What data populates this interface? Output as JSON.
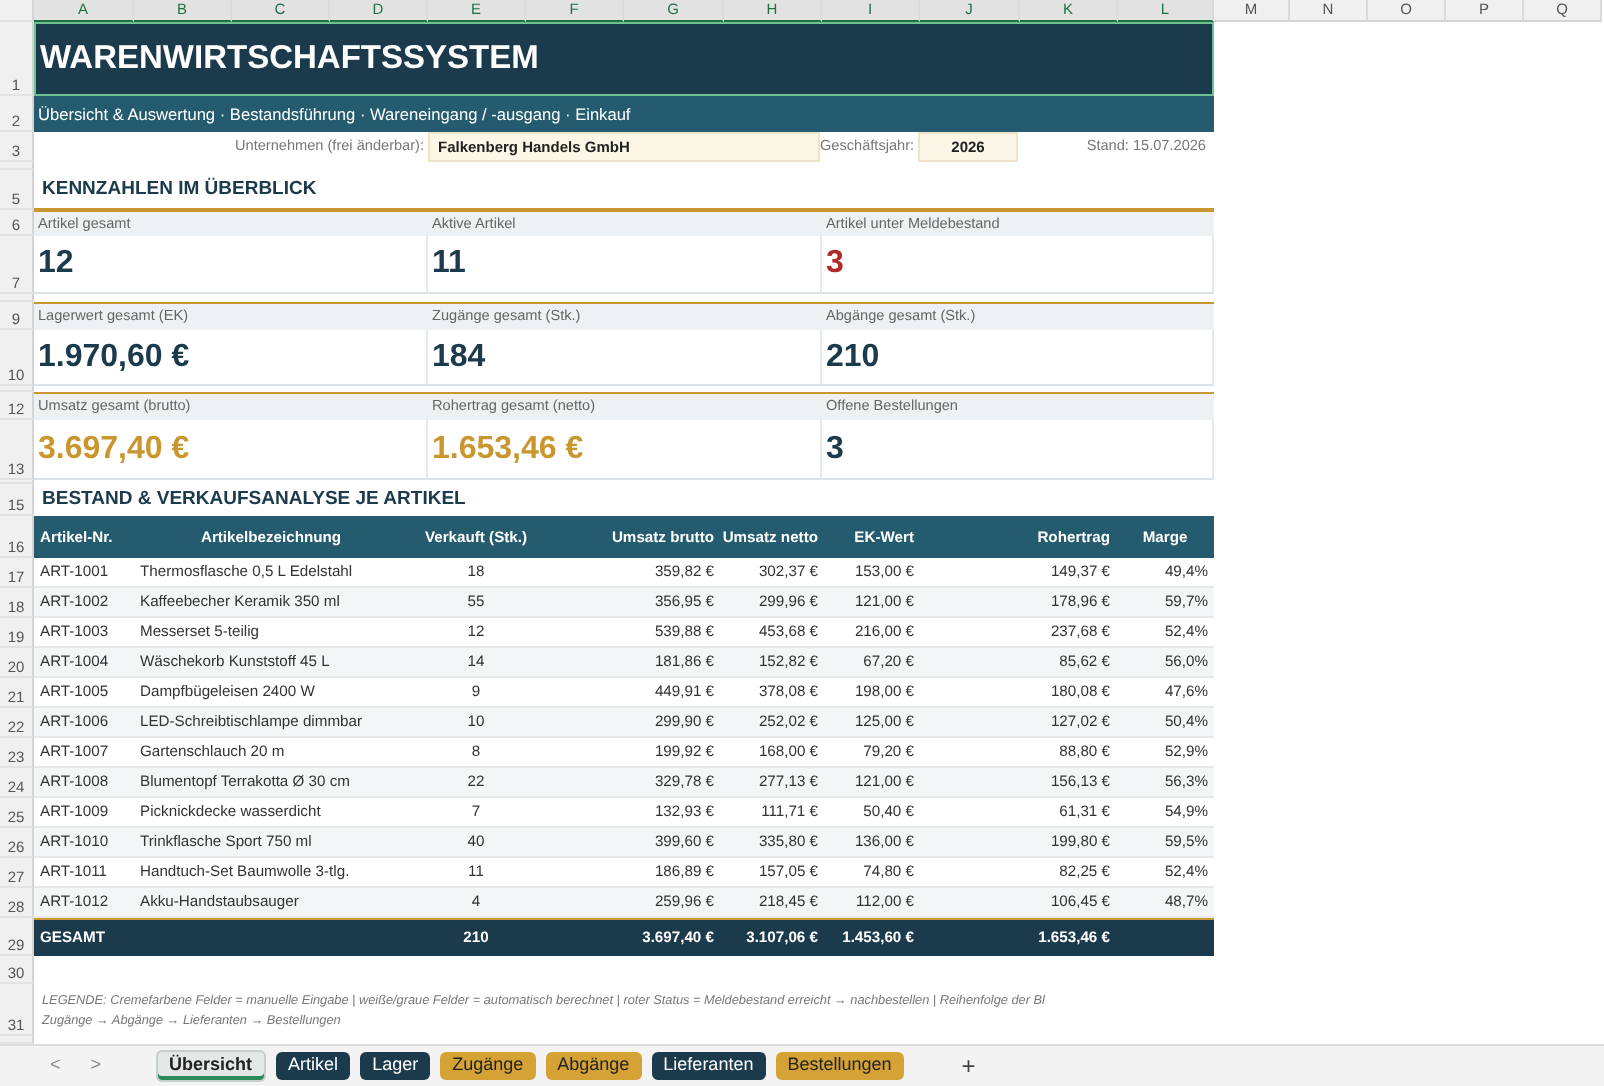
{
  "column_headers": [
    {
      "label": "A",
      "selected": true
    },
    {
      "label": "B",
      "selected": true
    },
    {
      "label": "C",
      "selected": true
    },
    {
      "label": "D",
      "selected": true
    },
    {
      "label": "E",
      "selected": true
    },
    {
      "label": "F",
      "selected": true
    },
    {
      "label": "G",
      "selected": true
    },
    {
      "label": "H",
      "selected": true
    },
    {
      "label": "I",
      "selected": true
    },
    {
      "label": "J",
      "selected": true
    },
    {
      "label": "K",
      "selected": true
    },
    {
      "label": "L",
      "selected": true
    },
    {
      "label": "M",
      "selected": false
    },
    {
      "label": "N",
      "selected": false
    },
    {
      "label": "O",
      "selected": false
    },
    {
      "label": "P",
      "selected": false
    },
    {
      "label": "Q",
      "selected": false
    }
  ],
  "row_headers": [
    "1",
    "2",
    "3",
    "5",
    "6",
    "7",
    "9",
    "10",
    "12",
    "13",
    "15",
    "16",
    "17",
    "18",
    "19",
    "20",
    "21",
    "22",
    "23",
    "24",
    "25",
    "26",
    "27",
    "28",
    "29",
    "30",
    "31"
  ],
  "title": {
    "text": "WARENWIRTSCHAFTSSYSTEM",
    "selected": true
  },
  "subtitle": "Übersicht & Auswertung · Bestandsführung · Wareneingang / -ausgang · Einkauf",
  "company": {
    "label": "Unternehmen (frei änderbar):",
    "value": "Falkenberg Handels GmbH"
  },
  "year": {
    "label": "Geschäftsjahr:",
    "value": "2026"
  },
  "stand": "Stand: 15.07.2026",
  "kpi_heading": "KENNZAHLEN IM ÜBERBLICK",
  "kpi_rows": [
    [
      {
        "label": "Artikel gesamt",
        "value": "12",
        "color": "#1b3a4b"
      },
      {
        "label": "Aktive Artikel",
        "value": "11",
        "color": "#1b3a4b"
      },
      {
        "label": "Artikel unter Meldebestand",
        "value": "3",
        "color": "#b02a2a"
      }
    ],
    [
      {
        "label": "Lagerwert gesamt (EK)",
        "value": "1.970,60 €",
        "color": "#1b3a4b"
      },
      {
        "label": "Zugänge gesamt (Stk.)",
        "value": "184",
        "color": "#1b3a4b"
      },
      {
        "label": "Abgänge gesamt (Stk.)",
        "value": "210",
        "color": "#1b3a4b"
      }
    ],
    [
      {
        "label": "Umsatz gesamt (brutto)",
        "value": "3.697,40 €",
        "color": "#c9962f"
      },
      {
        "label": "Rohertrag gesamt (netto)",
        "value": "1.653,46 €",
        "color": "#c9962f"
      },
      {
        "label": "Offene Bestellungen",
        "value": "3",
        "color": "#1b3a4b"
      }
    ]
  ],
  "table": {
    "heading": "BESTAND & VERKAUFSANALYSE JE ARTIKEL",
    "columns": [
      "Artikel-Nr.",
      "Artikelbezeichnung",
      "Verkauft (Stk.)",
      "Umsatz brutto",
      "Umsatz netto",
      "EK-Wert",
      "Rohertrag",
      "Marge"
    ],
    "rows": [
      [
        "ART-1001",
        "Thermosflasche 0,5 L Edelstahl",
        "18",
        "359,82 €",
        "302,37 €",
        "153,00 €",
        "149,37 €",
        "49,4%"
      ],
      [
        "ART-1002",
        "Kaffeebecher Keramik 350 ml",
        "55",
        "356,95 €",
        "299,96 €",
        "121,00 €",
        "178,96 €",
        "59,7%"
      ],
      [
        "ART-1003",
        "Messerset 5-teilig",
        "12",
        "539,88 €",
        "453,68 €",
        "216,00 €",
        "237,68 €",
        "52,4%"
      ],
      [
        "ART-1004",
        "Wäschekorb Kunststoff 45 L",
        "14",
        "181,86 €",
        "152,82 €",
        "67,20 €",
        "85,62 €",
        "56,0%"
      ],
      [
        "ART-1005",
        "Dampfbügeleisen 2400 W",
        "9",
        "449,91 €",
        "378,08 €",
        "198,00 €",
        "180,08 €",
        "47,6%"
      ],
      [
        "ART-1006",
        "LED-Schreibtischlampe dimmbar",
        "10",
        "299,90 €",
        "252,02 €",
        "125,00 €",
        "127,02 €",
        "50,4%"
      ],
      [
        "ART-1007",
        "Gartenschlauch 20 m",
        "8",
        "199,92 €",
        "168,00 €",
        "79,20 €",
        "88,80 €",
        "52,9%"
      ],
      [
        "ART-1008",
        "Blumentopf Terrakotta Ø 30 cm",
        "22",
        "329,78 €",
        "277,13 €",
        "121,00 €",
        "156,13 €",
        "56,3%"
      ],
      [
        "ART-1009",
        "Picknickdecke wasserdicht",
        "7",
        "132,93 €",
        "111,71 €",
        "50,40 €",
        "61,31 €",
        "54,9%"
      ],
      [
        "ART-1010",
        "Trinkflasche Sport 750 ml",
        "40",
        "399,60 €",
        "335,80 €",
        "136,00 €",
        "199,80 €",
        "59,5%"
      ],
      [
        "ART-1011",
        "Handtuch-Set Baumwolle 3-tlg.",
        "11",
        "186,89 €",
        "157,05 €",
        "74,80 €",
        "82,25 €",
        "52,4%"
      ],
      [
        "ART-1012",
        "Akku-Handstaubsauger",
        "4",
        "259,96 €",
        "218,45 €",
        "112,00 €",
        "106,45 €",
        "48,7%"
      ]
    ],
    "total": {
      "label": "GESAMT",
      "values": [
        "210",
        "3.697,40 €",
        "3.107,06 €",
        "1.453,60 €",
        "1.653,46 €"
      ]
    }
  },
  "legend": [
    "LEGENDE:  Cremefarbene Felder = manuelle Eingabe   |   weiße/graue Felder = automatisch berechnet   |   roter Status = Meldebestand erreicht → nachbestellen   |   Reihenfolge der Bl",
    "Zugänge → Abgänge → Lieferanten → Bestellungen"
  ],
  "sheet_nav": [
    "<",
    ">"
  ],
  "sheet_tabs": [
    {
      "label": "Übersicht",
      "selected": true,
      "color": "#e3e7e5"
    },
    {
      "label": "Artikel",
      "selected": false,
      "color": "#1b3a4b"
    },
    {
      "label": "Lager",
      "selected": false,
      "color": "#1b3a4b"
    },
    {
      "label": "Zugänge",
      "selected": false,
      "color": "#d4a235"
    },
    {
      "label": "Abgänge",
      "selected": false,
      "color": "#d4a235"
    },
    {
      "label": "Lieferanten",
      "selected": false,
      "color": "#1b3a4b"
    },
    {
      "label": "Bestellungen",
      "selected": false,
      "color": "#d4a235"
    }
  ],
  "add_sheet": "+"
}
